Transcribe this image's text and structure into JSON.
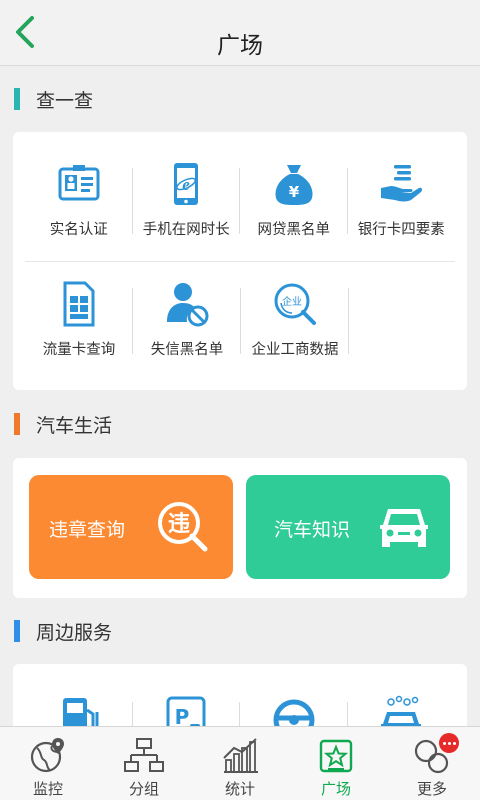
{
  "header": {
    "title": "广场"
  },
  "sections": {
    "check": {
      "title": "查一查",
      "color": "#2bb5b0"
    },
    "car": {
      "title": "汽车生活",
      "color": "#f07a2c"
    },
    "nearby": {
      "title": "周边服务",
      "color": "#2f8fe8"
    }
  },
  "check_items": [
    {
      "label": "实名认证",
      "icon": "id-card-icon"
    },
    {
      "label": "手机在网时长",
      "icon": "phone-ie-icon"
    },
    {
      "label": "网贷黑名单",
      "icon": "money-bag-icon"
    },
    {
      "label": "银行卡四要素",
      "icon": "hand-card-icon"
    },
    {
      "label": "流量卡查询",
      "icon": "sim-card-icon"
    },
    {
      "label": "失信黑名单",
      "icon": "user-blocked-icon"
    },
    {
      "label": "企业工商数据",
      "icon": "enterprise-search-icon"
    }
  ],
  "car_buttons": [
    {
      "label": "违章查询",
      "icon_text": "违",
      "color": "#fb8a33"
    },
    {
      "label": "汽车知识",
      "icon": "car-icon",
      "color": "#2fcc98"
    }
  ],
  "nearby_items": [
    {
      "icon": "gas-station-icon"
    },
    {
      "icon": "parking-icon"
    },
    {
      "icon": "steering-wheel-icon"
    },
    {
      "icon": "car-wash-icon"
    }
  ],
  "tabs": [
    {
      "label": "监控",
      "icon": "globe-pin-icon",
      "active": false
    },
    {
      "label": "分组",
      "icon": "org-chart-icon",
      "active": false
    },
    {
      "label": "统计",
      "icon": "bar-chart-icon",
      "active": false
    },
    {
      "label": "广场",
      "icon": "square-star-icon",
      "active": true
    },
    {
      "label": "更多",
      "icon": "circles-icon",
      "active": false
    }
  ],
  "colors": {
    "primary_blue": "#2b93d6",
    "active_green": "#10a84e",
    "badge_red": "#e62a2a"
  }
}
